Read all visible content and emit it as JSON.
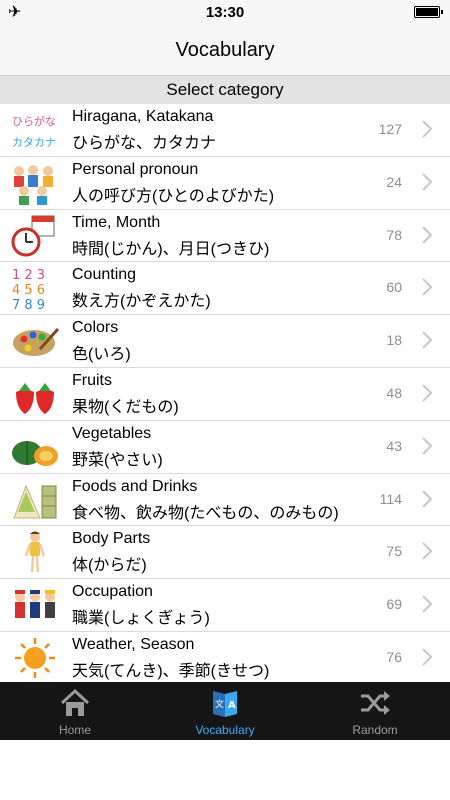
{
  "status_bar": {
    "time": "13:30",
    "plane_icon": "airplane-icon",
    "battery_icon": "battery-icon"
  },
  "header": {
    "title": "Vocabulary"
  },
  "list": {
    "section_title": "Select category",
    "items": [
      {
        "english": "Hiragana, Katakana",
        "japanese": "ひらがな、カタカナ",
        "count": "127",
        "thumb_lines": [
          "ひらがな",
          "カタカナ"
        ],
        "icon": "kana-icon"
      },
      {
        "english": "Personal pronoun",
        "japanese": "人の呼び方(ひとのよびかた)",
        "count": "24",
        "icon": "people-icon"
      },
      {
        "english": "Time, Month",
        "japanese": "時間(じかん)、月日(つきひ)",
        "count": "78",
        "icon": "clock-calendar-icon"
      },
      {
        "english": "Counting",
        "japanese": "数え方(かぞえかた)",
        "count": "60",
        "thumb_lines": [
          "1 2 3",
          "4 5 6",
          "7 8 9"
        ],
        "icon": "numbers-icon"
      },
      {
        "english": "Colors",
        "japanese": "色(いろ)",
        "count": "18",
        "icon": "palette-icon"
      },
      {
        "english": "Fruits",
        "japanese": "果物(くだもの)",
        "count": "48",
        "icon": "strawberry-icon"
      },
      {
        "english": "Vegetables",
        "japanese": "野菜(やさい)",
        "count": "43",
        "icon": "pumpkin-icon"
      },
      {
        "english": "Foods and Drinks",
        "japanese": "食べ物、飲み物(たべもの、のみもの)",
        "count": "114",
        "icon": "sandwich-icon"
      },
      {
        "english": "Body Parts",
        "japanese": "体(からだ)",
        "count": "75",
        "icon": "body-icon"
      },
      {
        "english": "Occupation",
        "japanese": "職業(しょくぎょう)",
        "count": "69",
        "icon": "workers-icon"
      },
      {
        "english": "Weather, Season",
        "japanese": "天気(てんき)、季節(きせつ)",
        "count": "76",
        "icon": "sun-icon"
      }
    ]
  },
  "tab_bar": {
    "tabs": [
      {
        "label": "Home",
        "icon": "home-icon",
        "active": false
      },
      {
        "label": "Vocabulary",
        "icon": "vocabulary-icon",
        "active": true
      },
      {
        "label": "Random",
        "icon": "shuffle-icon",
        "active": false
      }
    ],
    "active_color": "#3aa9f2",
    "inactive_color": "#9a9a9a"
  }
}
